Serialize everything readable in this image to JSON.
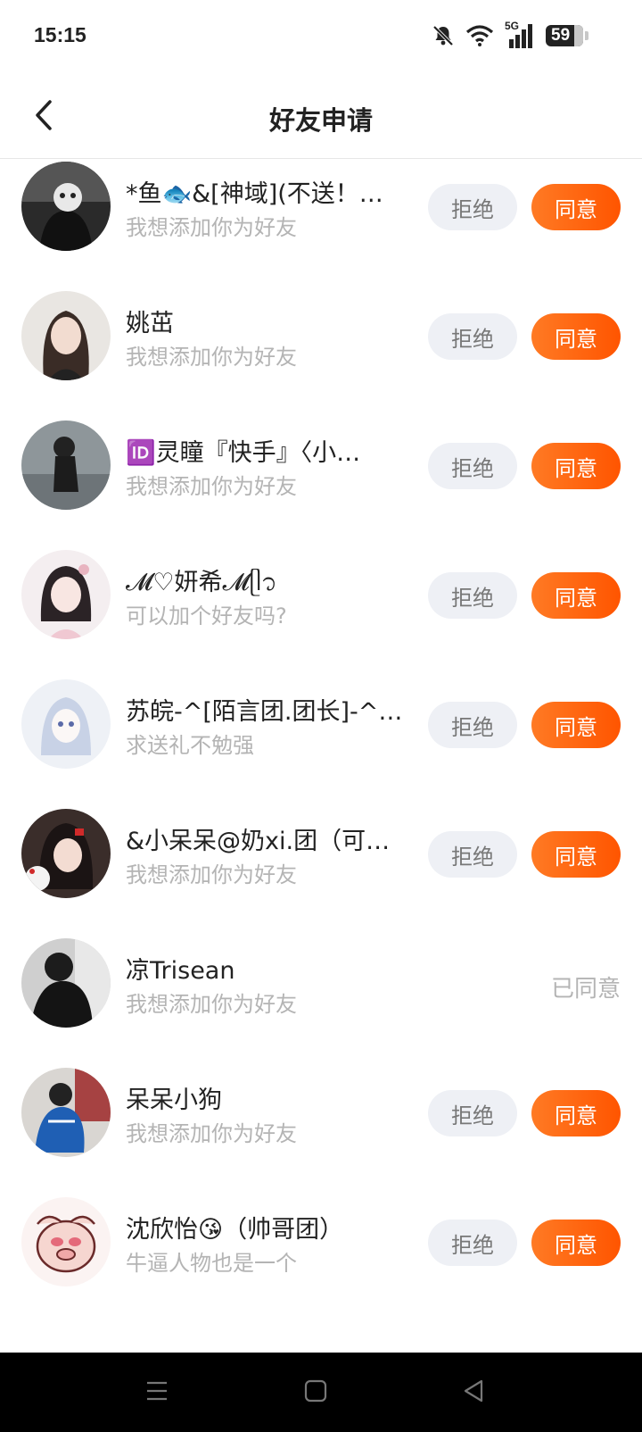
{
  "status_bar": {
    "time": "15:15",
    "network": "5G",
    "battery": "59",
    "icons": [
      "mute-bell-icon",
      "wifi-icon",
      "signal-icon",
      "battery-icon"
    ]
  },
  "header": {
    "title": "好友申请",
    "back_icon": "chevron-left-icon"
  },
  "labels": {
    "reject": "拒绝",
    "accept": "同意",
    "accepted": "已同意"
  },
  "requests": [
    {
      "name": "*鱼🐟&[神域](不送！…",
      "message": "我想添加你为好友",
      "status": "pending"
    },
    {
      "name": "姚茁",
      "message": "我想添加你为好友",
      "status": "pending"
    },
    {
      "name": "🆔灵瞳『快手』〈小…",
      "message": "我想添加你为好友",
      "status": "pending"
    },
    {
      "name": "𝓜♡妍希𝓜ᥫ᭡",
      "message": "可以加个好友吗?",
      "status": "pending"
    },
    {
      "name": "苏皖-^[陌言团.团长]-^…",
      "message": "求送礼不勉强",
      "status": "pending"
    },
    {
      "name": "&小呆呆@奶xi.团（可…",
      "message": "我想添加你为好友",
      "status": "pending"
    },
    {
      "name": "凉Trisean",
      "message": "我想添加你为好友",
      "status": "accepted"
    },
    {
      "name": "呆呆小狗",
      "message": "我想添加你为好友",
      "status": "pending"
    },
    {
      "name": "沈欣怡😘（帅哥团）",
      "message": "牛逼人物也是一个",
      "status": "pending"
    }
  ],
  "colors": {
    "accent": "#ff5e0e",
    "reject_bg": "#eef0f5",
    "muted_text": "#b4b4b4"
  },
  "system_nav": [
    "menu-icon",
    "home-icon",
    "back-triangle-icon"
  ]
}
